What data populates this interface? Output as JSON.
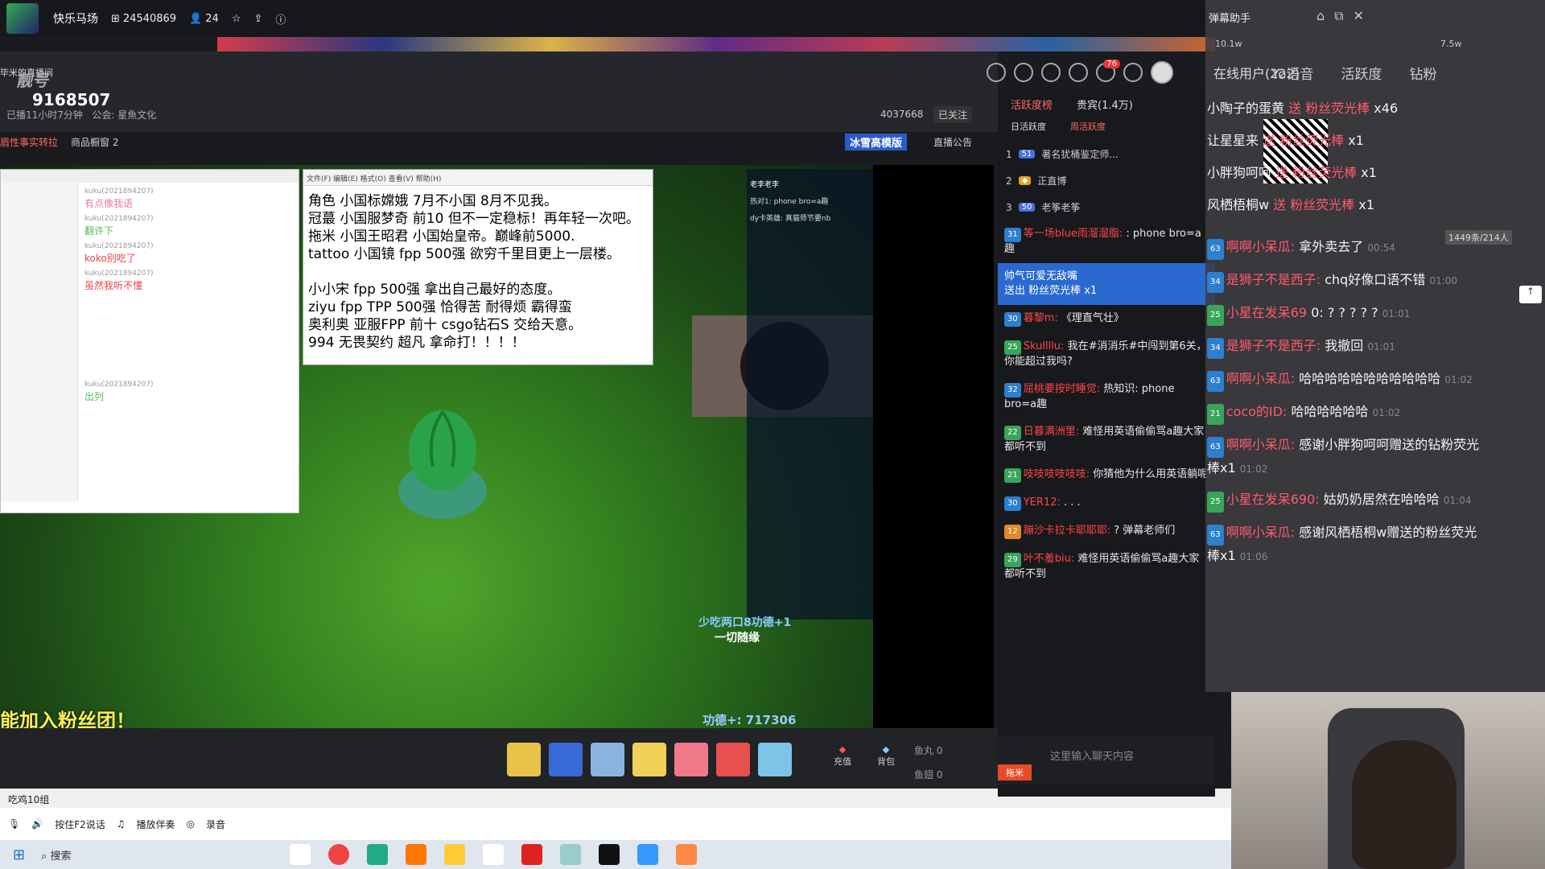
{
  "top": {
    "name": "快乐马场",
    "fans": "24540869",
    "users": "24"
  },
  "room": {
    "id_tag": "靓号",
    "number": "9168507",
    "live_time": "已播11小时7分钟",
    "guild": "公会: 星魚文化",
    "tab_left": "眉性事实转拉",
    "shop": "商品橱窗 2",
    "host_count": "4037668",
    "follow": "已关注",
    "client": "冰雪高模版",
    "notice": "直播公告",
    "badge": "76",
    "header_left": "毕米的直播间"
  },
  "notepad": {
    "title": "文件(F) 编辑(E) 格式(O) 查看(V) 帮助(H)",
    "lines": "角色 小国标嫦娥 7月不小国 8月不见我。\n冠蕞 小国服梦奇 前10 但不一定稳标！再年轻一次吧。\n拖米 小国王昭君 小国始皇帝。巅峰前5000.\ntattoo 小国镜 fpp 500强 欲穷千里目更上一层楼。\n\n小小宋  fpp 500强 拿出自己最好的态度。\nziyu fpp TPP 500强 恰得苦   耐得烦   霸得蛮\n奥利奥 亚服FPP 前十 csgo钻石S 交给天意。\n994 无畏契约 超凡 拿命打！！！！"
  },
  "chatwin": {
    "items": [
      "有点像我语",
      "翻许下",
      "koko别吃了",
      "虽然我听不懂",
      "出列"
    ]
  },
  "stream_side": {
    "lines": [
      "老李老李",
      "少吃两口8功德+1",
      "一切随缘",
      "热对1: phone bro=a趣",
      "dy卡英雄: 真猫师节要nb"
    ]
  },
  "overlay": {
    "fans": "能加入粉丝团！",
    "gongde": "功德+: 717306",
    "gift1": "少吃两口8功德+1",
    "gift2": "一切随缘"
  },
  "giftbar": {
    "recharge": "充值",
    "bag": "背包",
    "fishball": "鱼丸",
    "fishball_val": "0",
    "fishbone": "鱼翅",
    "fishbone_val": "0",
    "input_placeholder": "这里输入聊天内容",
    "send": "拖米"
  },
  "statusbar": {
    "text": "吃鸡10组"
  },
  "toolbar2": {
    "items": [
      "按住F2说话",
      "播放伴奏",
      "录音"
    ]
  },
  "taskbar": {
    "search": "搜索"
  },
  "center_chat": {
    "tabs": [
      "活跃度榜",
      "贵宾(1.4万)"
    ],
    "subtabs": [
      "日活跃度",
      "周活跃度"
    ],
    "ranks": [
      {
        "rank": "1",
        "level": "51",
        "name": "著名犹桶鉴定师..."
      },
      {
        "rank": "2",
        "level": "",
        "name": "正直博"
      },
      {
        "rank": "3",
        "level": "50",
        "name": "老筝老筝"
      }
    ],
    "messages": [
      {
        "lvl": "31",
        "name": "等一场blue雨溜溜脂:",
        "text": ": phone bro=a趣"
      },
      {
        "lvl": "",
        "name": "帅气可爱无敌嘴",
        "text": "送出 粉丝荧光棒 x1"
      },
      {
        "lvl": "30",
        "name": "暮黎m:",
        "text": "《理直气壮》"
      },
      {
        "lvl": "25",
        "name": "Skullllu:",
        "text": "我在#消消乐#中闯到第6关，你能超过我吗?"
      },
      {
        "lvl": "32",
        "name": "屈桃要按时睡觉:",
        "text": "热知识: phone bro=a趣"
      },
      {
        "lvl": "22",
        "name": "日暮满洲里:",
        "text": "难怪用英语偷偷骂a趣大家都听不到"
      },
      {
        "lvl": "21",
        "name": "吱吱吱吱吱吱:",
        "text": "你猜他为什么用英语躺呢"
      },
      {
        "lvl": "30",
        "name": "YER12:",
        "text": ". . ."
      },
      {
        "lvl": "12",
        "name": "蹦沙卡拉卡耶耶耶:",
        "text": "? 弹幕老师们"
      },
      {
        "lvl": "29",
        "name": "叶不羞biu:",
        "text": "难怪用英语偷偷骂a趣大家都听不到"
      }
    ]
  },
  "right_panel": {
    "title": "弹幕助手",
    "online": "在线用户(222)",
    "tabs": [
      "Yo语音",
      "活跃度",
      "钻粉"
    ],
    "stats_left": "10.1w",
    "stats_right": "7.5w",
    "count": "1449条/214人",
    "gifts": [
      {
        "name": "小陶子的蛋黄",
        "text": "送 粉丝荧光棒",
        "qty": "x46"
      },
      {
        "name": "让星星来",
        "text": "送 粉丝荧光棒",
        "qty": "x1"
      },
      {
        "name": "小胖狗呵呵",
        "text": "送 粉丝荧光棒",
        "qty": "x1"
      },
      {
        "name": "风栖梧桐w",
        "text": "送 粉丝荧光棒",
        "qty": "x1"
      }
    ],
    "messages": [
      {
        "name": "啊啊小呆瓜:",
        "text": "拿外卖去了",
        "ts": "00:54"
      },
      {
        "name": "是狮子不是西子:",
        "text": "chq好像口语不错",
        "ts": "01:00"
      },
      {
        "name": "小星在发呆69",
        "text": "0: ? ? ? ? ?",
        "ts": "01:01"
      },
      {
        "name": "是狮子不是西子:",
        "text": "我撤回",
        "ts": "01:01"
      },
      {
        "name": "啊啊小呆瓜:",
        "text": "哈哈哈哈哈哈哈哈哈哈哈",
        "ts": "01:02"
      },
      {
        "name": "coco的ID:",
        "text": "哈哈哈哈哈哈",
        "ts": "01:02"
      },
      {
        "name": "啊啊小呆瓜:",
        "text": "感谢小胖狗呵呵赠送的钻粉荧光棒x1",
        "ts": "01:02"
      },
      {
        "name": "小星在发呆690:",
        "text": "姑奶奶居然在哈哈哈",
        "ts": "01:04"
      },
      {
        "name": "啊啊小呆瓜:",
        "text": "感谢风栖梧桐w赠送的粉丝荧光棒x1",
        "ts": "01:06"
      }
    ]
  }
}
